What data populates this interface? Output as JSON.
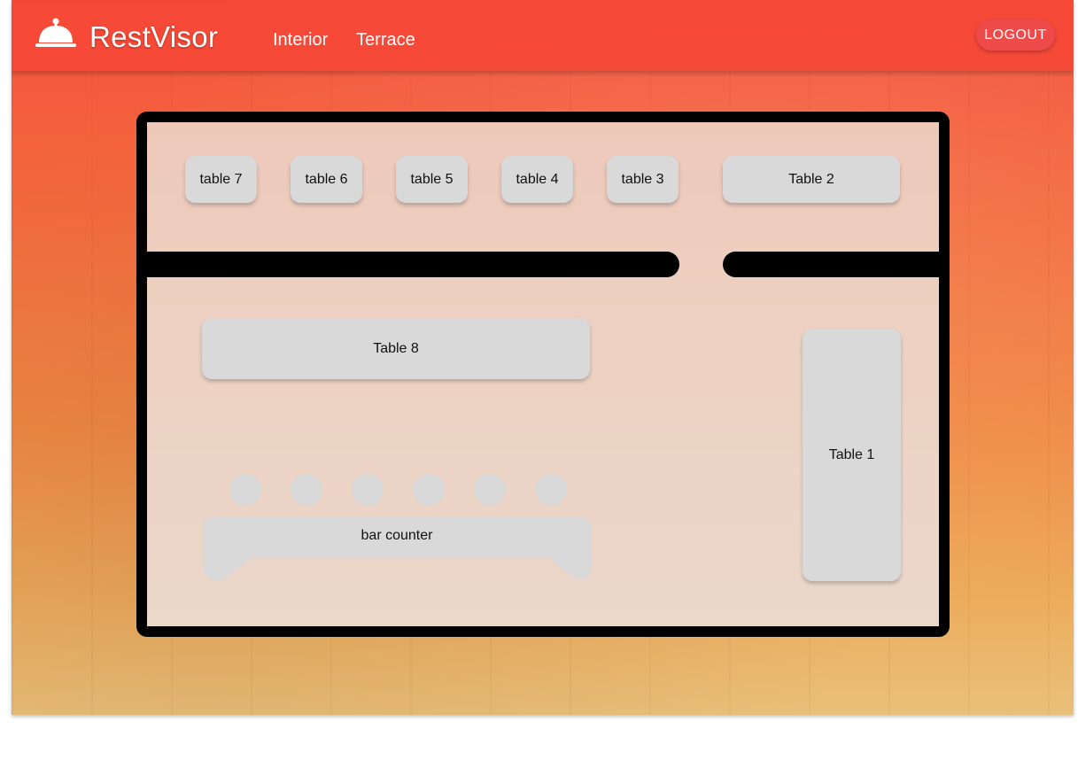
{
  "brand": {
    "name": "RestVisor",
    "icon": "cloche-icon"
  },
  "nav": {
    "items": [
      "Interior",
      "Terrace"
    ]
  },
  "header": {
    "logout_label": "LOGOUT"
  },
  "floor_plan": {
    "tables": {
      "t7": "table 7",
      "t6": "table 6",
      "t5": "table 5",
      "t4": "table 4",
      "t3": "table 3",
      "t2": "Table 2",
      "t8": "Table 8",
      "t1": "Table 1"
    },
    "bar_counter": "bar counter"
  },
  "colors": {
    "header": "#f54837",
    "logout": "#ef4a4a",
    "table": "#d9d9d9",
    "walls": "#000000"
  }
}
